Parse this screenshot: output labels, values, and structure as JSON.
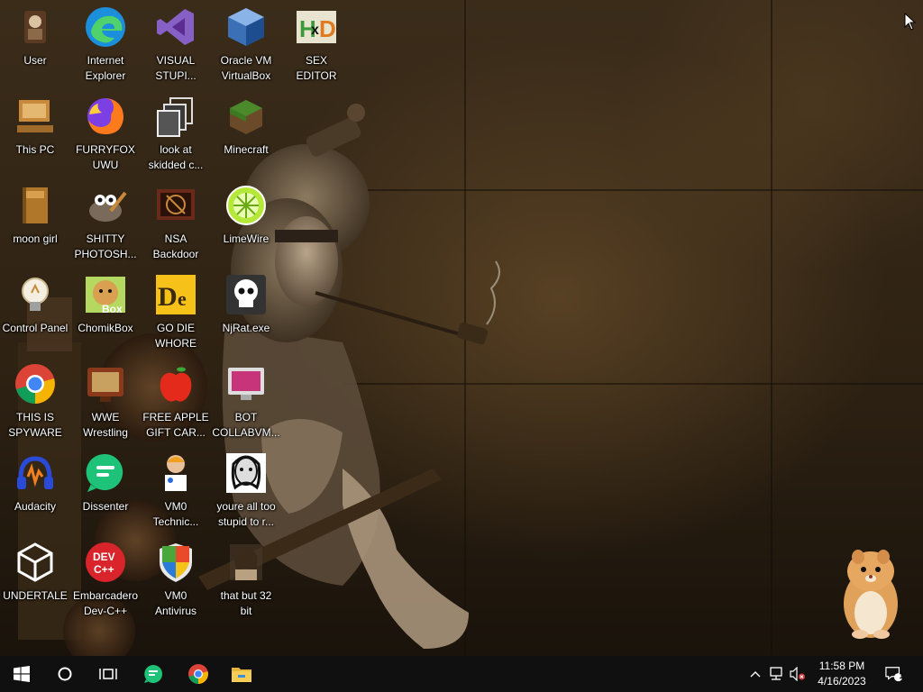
{
  "desktop": {
    "icons": [
      {
        "id": "user",
        "label": "User",
        "icon": "user-folder-icon"
      },
      {
        "id": "internet-explorer",
        "label": "Internet\nExplorer",
        "icon": "edge-browser-icon"
      },
      {
        "id": "visual-studio",
        "label": "VISUAL\nSTUPI...",
        "icon": "visual-studio-icon"
      },
      {
        "id": "virtualbox",
        "label": "Oracle VM\nVirtualBox",
        "icon": "virtualbox-cube-icon"
      },
      {
        "id": "sex-editor",
        "label": "SEX\nEDITOR",
        "icon": "hxd-hex-editor-icon"
      },
      {
        "id": "this-pc",
        "label": "This PC",
        "icon": "computer-icon"
      },
      {
        "id": "furryfox",
        "label": "FURRYFOX\nUWU",
        "icon": "firefox-icon"
      },
      {
        "id": "skidded",
        "label": "look at\nskidded c...",
        "icon": "copy-windows-icon"
      },
      {
        "id": "minecraft",
        "label": "Minecraft",
        "icon": "grass-block-icon"
      },
      {
        "id": "moon-girl",
        "label": "moon girl",
        "icon": "book-icon"
      },
      {
        "id": "gimp",
        "label": "SHITTY\nPHOTOSH...",
        "icon": "gimp-icon"
      },
      {
        "id": "nsa-backdoor",
        "label": "NSA\nBackdoor",
        "icon": "terminal-icon"
      },
      {
        "id": "limewire",
        "label": "LimeWire",
        "icon": "limewire-icon"
      },
      {
        "id": "control-panel",
        "label": "Control Panel",
        "icon": "lightbulb-icon"
      },
      {
        "id": "chomikbox",
        "label": "ChomikBox",
        "icon": "hamster-box-icon"
      },
      {
        "id": "go-die",
        "label": "GO DIE\nWHORE",
        "icon": "dev-editor-icon"
      },
      {
        "id": "njrat",
        "label": "NjRat.exe",
        "icon": "skull-icon"
      },
      {
        "id": "spyware",
        "label": "THIS IS\nSPYWARE",
        "icon": "chrome-icon"
      },
      {
        "id": "wwe",
        "label": "WWE\nWrestling",
        "icon": "tv-icon"
      },
      {
        "id": "apple",
        "label": "FREE APPLE\nGIFT CAR...",
        "icon": "apple-icon"
      },
      {
        "id": "bot",
        "label": "BOT\nCOLLABVM...",
        "icon": "monitor-icon"
      },
      {
        "id": "audacity",
        "label": "Audacity",
        "icon": "headphones-icon"
      },
      {
        "id": "dissenter",
        "label": "Dissenter",
        "icon": "speech-bubble-icon"
      },
      {
        "id": "vm0-tech",
        "label": "VM0\nTechnic...",
        "icon": "technician-icon"
      },
      {
        "id": "stupid",
        "label": "youre all too\nstupid to r...",
        "icon": "face-portrait-icon"
      },
      {
        "id": "undertale",
        "label": "UNDERTALE",
        "icon": "unity-icon"
      },
      {
        "id": "devcpp",
        "label": "Embarcadero\nDev-C++",
        "icon": "devcpp-icon"
      },
      {
        "id": "vm0-antivirus",
        "label": "VM0\nAntivirus",
        "icon": "shield-icon"
      },
      {
        "id": "32bit",
        "label": "that but 32\nbit",
        "icon": "portrait-icon"
      }
    ]
  },
  "taskbar": {
    "start_icon": "windows-logo-icon",
    "search_icon": "cortana-circle-icon",
    "taskview_icon": "task-view-icon",
    "pinned": [
      {
        "name": "dissenter",
        "icon": "speech-bubble-icon"
      },
      {
        "name": "chrome",
        "icon": "chrome-icon"
      },
      {
        "name": "file-explorer",
        "icon": "folder-icon"
      }
    ],
    "tray": {
      "chevron_icon": "chevron-up-icon",
      "network_icon": "network-icon",
      "volume_icon": "volume-muted-icon",
      "time": "11:58 PM",
      "date": "4/16/2023",
      "notifications_count": "1"
    }
  },
  "colors": {
    "taskbar": "#101010",
    "wallpaper": "#3b2c1a"
  }
}
